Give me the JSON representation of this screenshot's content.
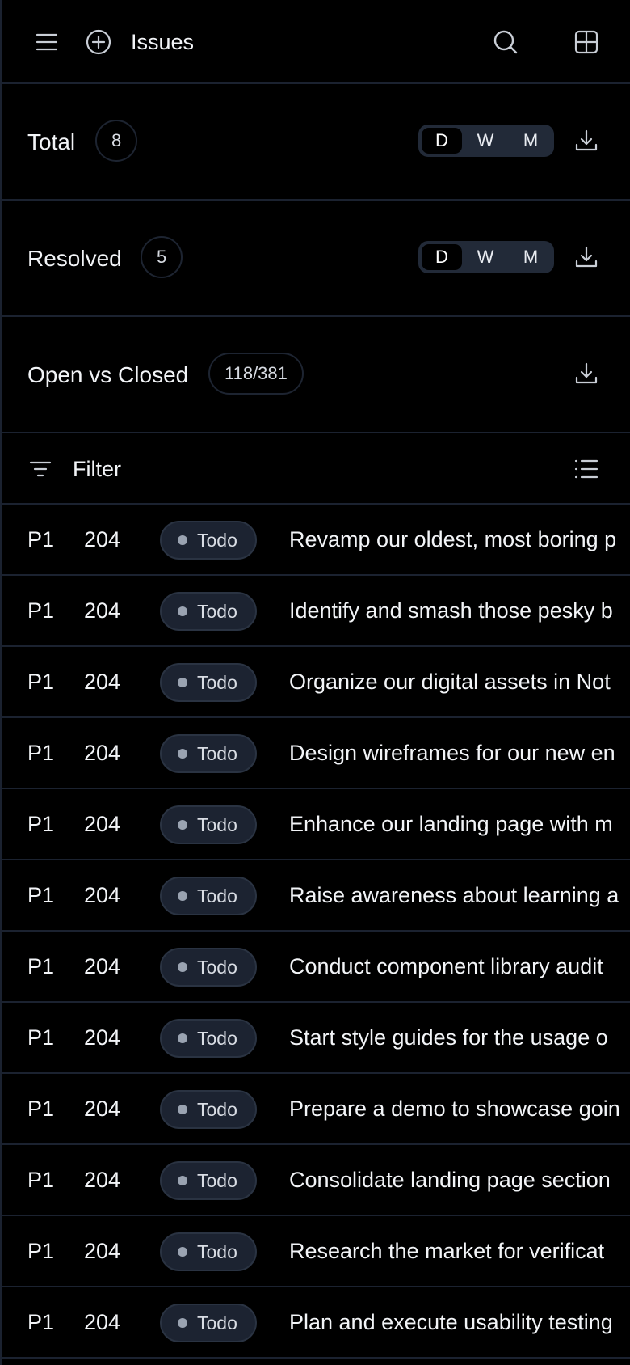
{
  "header": {
    "title": "Issues",
    "icons": [
      "menu-icon",
      "plus-circle-icon",
      "search-icon",
      "grid-icon"
    ]
  },
  "stats": [
    {
      "label": "Total",
      "value": "8",
      "has_range": true
    },
    {
      "label": "Resolved",
      "value": "5",
      "has_range": true
    },
    {
      "label": "Open vs Closed",
      "value": "118/381",
      "has_range": false
    }
  ],
  "range_options": [
    "D",
    "W",
    "M"
  ],
  "range_selected": "D",
  "filter": {
    "label": "Filter"
  },
  "issues": [
    {
      "priority": "P1",
      "number": "204",
      "status": "Todo",
      "title": "Revamp our oldest, most boring p"
    },
    {
      "priority": "P1",
      "number": "204",
      "status": "Todo",
      "title": "Identify and smash those pesky b"
    },
    {
      "priority": "P1",
      "number": "204",
      "status": "Todo",
      "title": "Organize our digital assets in Not"
    },
    {
      "priority": "P1",
      "number": "204",
      "status": "Todo",
      "title": "Design wireframes for our new en"
    },
    {
      "priority": "P1",
      "number": "204",
      "status": "Todo",
      "title": "Enhance our landing page with m"
    },
    {
      "priority": "P1",
      "number": "204",
      "status": "Todo",
      "title": "Raise awareness about learning a"
    },
    {
      "priority": "P1",
      "number": "204",
      "status": "Todo",
      "title": "Conduct component library audit"
    },
    {
      "priority": "P1",
      "number": "204",
      "status": "Todo",
      "title": "Start style guides for the usage o"
    },
    {
      "priority": "P1",
      "number": "204",
      "status": "Todo",
      "title": "Prepare a demo to showcase goin"
    },
    {
      "priority": "P1",
      "number": "204",
      "status": "Todo",
      "title": "Consolidate landing page section"
    },
    {
      "priority": "P1",
      "number": "204",
      "status": "Todo",
      "title": "Research the market for verificat"
    },
    {
      "priority": "P1",
      "number": "204",
      "status": "Todo",
      "title": "Plan and execute usability testing"
    }
  ],
  "colors": {
    "background": "#000000",
    "divider": "#1b2230",
    "pill_bg": "#1c2331",
    "segment_bg": "#222a38",
    "text": "#f2f4f7",
    "status_dot": "#9aa3b1"
  }
}
